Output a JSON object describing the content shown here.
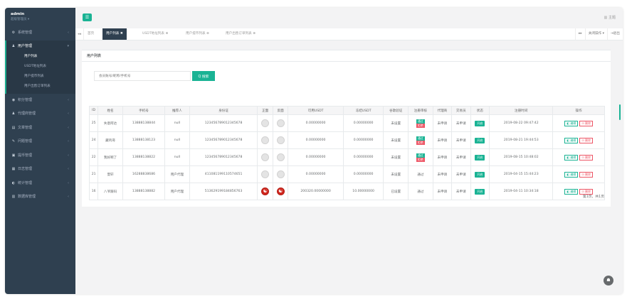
{
  "profile": {
    "name": "admin",
    "role": "超级管理员 ▾"
  },
  "sidebar": {
    "items": [
      {
        "label": "系统管理",
        "icon": "gear-icon",
        "glyph": "⚙"
      },
      {
        "label": "用户管理",
        "icon": "user-icon",
        "glyph": "♟",
        "expanded": true
      },
      {
        "label": "积分管理",
        "icon": "points-icon",
        "glyph": "◉"
      },
      {
        "label": "代理商管理",
        "icon": "agent-icon",
        "glyph": "♟"
      },
      {
        "label": "文章管理",
        "icon": "article-icon",
        "glyph": "▤"
      },
      {
        "label": "问题管理",
        "icon": "question-icon",
        "glyph": "✎"
      },
      {
        "label": "提币管理",
        "icon": "withdraw-icon",
        "glyph": "▣"
      },
      {
        "label": "日志管理",
        "icon": "log-icon",
        "glyph": "▦"
      },
      {
        "label": "统计管理",
        "icon": "stats-icon",
        "glyph": "◐"
      },
      {
        "label": "数据库管理",
        "icon": "database-icon",
        "glyph": "▥"
      }
    ],
    "sub_items": [
      "用户列表",
      "USDT地址列表",
      "用户提币列表",
      "用户出售订单列表"
    ]
  },
  "header": {
    "menu_icon": "☰",
    "home_link": "▥ 主题"
  },
  "tabs": {
    "prev": "◂◂",
    "items": [
      {
        "label": "首页"
      },
      {
        "label": "用户列表 ✖"
      },
      {
        "label": "USDT地址列表 ⊗"
      },
      {
        "label": "用户提币列表 ⊗"
      },
      {
        "label": "用户出售订单列表 ⊗"
      }
    ],
    "next": "▸▸",
    "actions_label": "关闭操作 ▾",
    "exit_label": "⇥退出"
  },
  "panel": {
    "title": "用户列表"
  },
  "search": {
    "placeholder": "会员账号/昵称/手机号",
    "button": "Q 搜索"
  },
  "table": {
    "headers": [
      "ID",
      "姓名",
      "手机号",
      "推荐人",
      "身份证",
      "正面",
      "反面",
      "可用USDT",
      "冻结USDT",
      "谷歌验证",
      "注册审核",
      "代理商",
      "交易员",
      "状态",
      "注册时间",
      "操作"
    ],
    "rows": [
      {
        "id": "25",
        "name": "失意阿达",
        "phone": "13888138844",
        "referrer": "null",
        "idcard": "123456789012345678",
        "front": "gray",
        "back": "gray",
        "usdt": "0.00000000",
        "frozen": "0.00000000",
        "google": "未设置",
        "review": [
          "通过",
          "拒绝"
        ],
        "agent": "未申请",
        "trader": "未申请",
        "status": "开启",
        "time": "2019-08-22 09:47:42"
      },
      {
        "id": "24",
        "name": "藏鸡哥",
        "phone": "13888138123",
        "referrer": "null",
        "idcard": "123456789012345678",
        "front": "gray",
        "back": "gray",
        "usdt": "0.00000000",
        "frozen": "0.00000000",
        "google": "未设置",
        "review": [
          "通过",
          "拒绝"
        ],
        "agent": "未申请",
        "trader": "未申请",
        "status": "开启",
        "time": "2019-08-21 19:44:53"
      },
      {
        "id": "22",
        "name": "我好啊了",
        "phone": "13888138822",
        "referrer": "null",
        "idcard": "123456789012345678",
        "front": "gray",
        "back": "gray",
        "usdt": "0.00000000",
        "frozen": "0.00000000",
        "google": "未设置",
        "review": [
          "通过",
          "拒绝"
        ],
        "agent": "未申请",
        "trader": "未申请",
        "status": "开启",
        "time": "2019-08-15 10:48:02"
      },
      {
        "id": "21",
        "name": "萱轩",
        "phone": "16288838686",
        "referrer": "用户代理",
        "idcard": "411081199110574651",
        "front": "gray",
        "back": "gray",
        "usdt": "0.00000000",
        "frozen": "0.00000000",
        "google": "未设置",
        "review": [
          "通过"
        ],
        "agent": "未申请",
        "trader": "未申请",
        "status": "开启",
        "time": "2019-04-15 15:44:23"
      },
      {
        "id": "16",
        "name": "八爷跟码",
        "phone": "13888138882",
        "referrer": "用户代理",
        "idcard": "513629199184856763",
        "front": "red",
        "back": "red",
        "usdt": "200320.00000000",
        "frozen": "10.00000000",
        "google": "已设置",
        "review": [
          "通过"
        ],
        "agent": "未申请",
        "trader": "未申请",
        "status": "开启",
        "time": "2019-04-11 10:34:18"
      }
    ],
    "edit_label": "◧ 编辑",
    "delete_label": "⊡ 删除"
  },
  "pager": "第1页，共1页",
  "fab_icon": "☗",
  "colors": {
    "sidebar": "#2f4050",
    "accent": "#1ab394",
    "danger": "#ed5565"
  }
}
